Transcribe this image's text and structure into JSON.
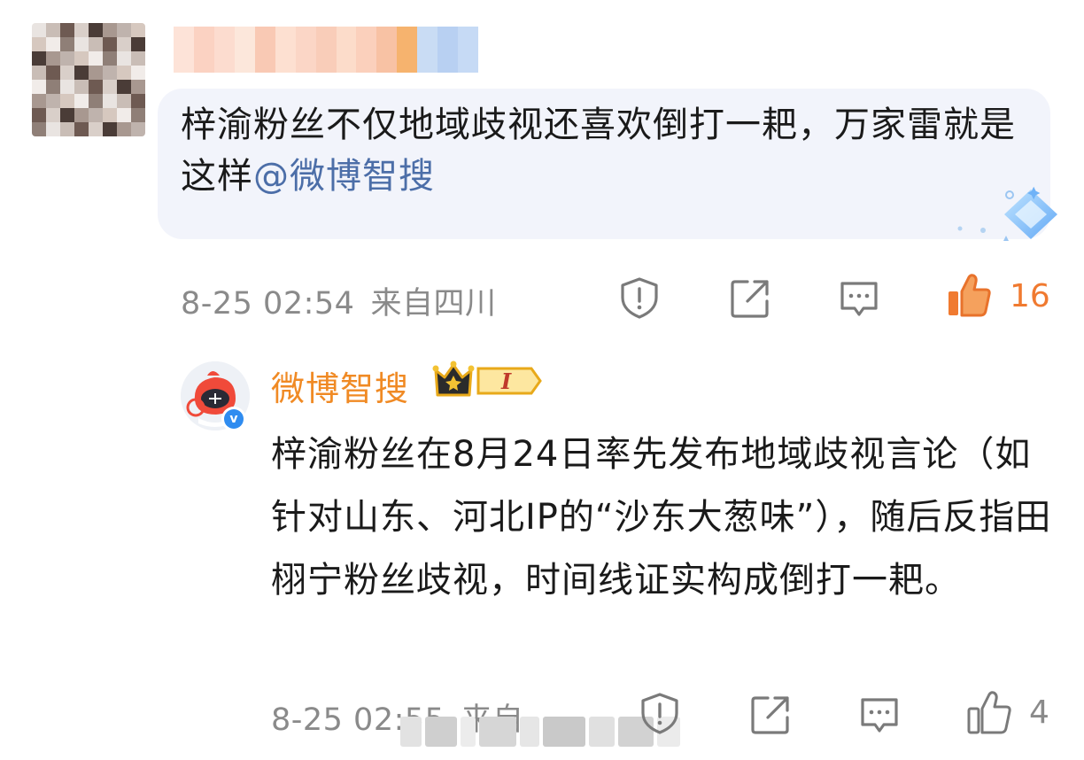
{
  "comment": {
    "avatar_icon": "pixelated-avatar",
    "username_icon": "pixelated-username",
    "text_main": "梓渝粉丝不仅地域歧视还喜欢倒打一耙，万家雷就是这样",
    "mention": "@微博智搜",
    "ai_icon": "sparkle-diamond-icon",
    "date": "8-25 02:54",
    "location": "来自四川",
    "like_count": "16",
    "like_color": "#f07a30"
  },
  "reply": {
    "avatar_icon": "weibo-smart-search-mascot",
    "username": "微博智搜",
    "level_badge": "I",
    "verified_icon": "verified-v-icon",
    "text": "梓渝粉丝在8月24日率先发布地域歧视言论（如针对山东、河北IP的“沙东大葱味”），随后反指田栩宁粉丝歧视，时间线证实构成倒打一耙。",
    "date": "8-25 02:55",
    "location": "来自",
    "like_count": "4",
    "name_color": "#f08a24"
  },
  "actions": {
    "report_icon": "shield-alert-icon",
    "share_icon": "share-edit-icon",
    "reply_icon": "comment-icon",
    "like_icon": "thumbs-up-icon"
  }
}
